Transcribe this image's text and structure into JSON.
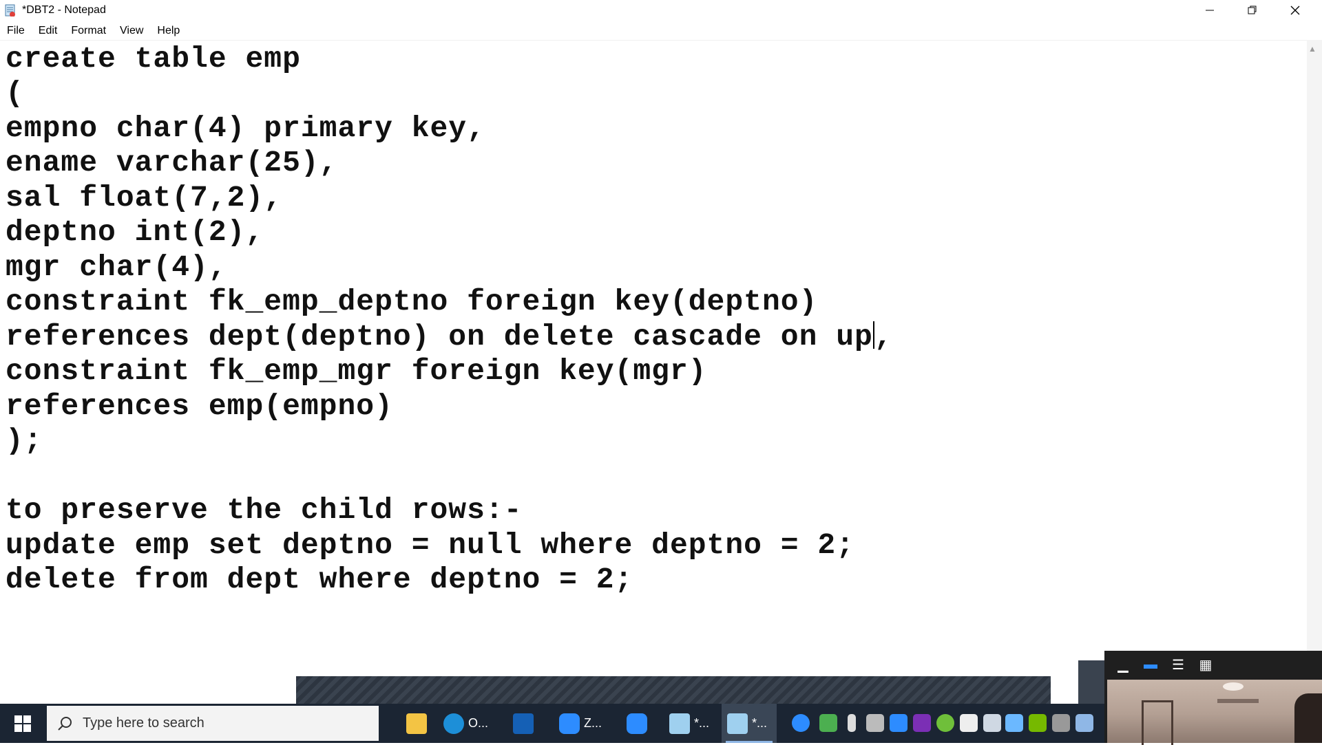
{
  "window": {
    "title": "*DBT2 - Notepad"
  },
  "menu": [
    "File",
    "Edit",
    "Format",
    "View",
    "Help"
  ],
  "editor": {
    "lines": [
      "create table emp",
      "(",
      "empno char(4) primary key,",
      "ename varchar(25),",
      "sal float(7,2),",
      "deptno int(2),",
      "mgr char(4),",
      "constraint fk_emp_deptno foreign key(deptno)",
      "references dept(deptno) on delete cascade on up",
      "constraint fk_emp_mgr foreign key(mgr)",
      "references emp(empno)",
      ");",
      "",
      "to preserve the child rows:-",
      "update emp set deptno = null where deptno = 2;",
      "delete from dept where deptno = 2;"
    ],
    "caret_suffix": ","
  },
  "taskbar": {
    "search_placeholder": "Type here to search",
    "apps": [
      {
        "icon": "file-explorer-icon",
        "label": ""
      },
      {
        "icon": "edge-icon",
        "label": "O..."
      },
      {
        "icon": "whiteboard-icon",
        "label": ""
      },
      {
        "icon": "zoom-icon",
        "label": "Z..."
      },
      {
        "icon": "zoom-meeting-icon",
        "label": ""
      },
      {
        "icon": "notepad-icon",
        "label": "*..."
      },
      {
        "icon": "notepad-icon",
        "label": "*..."
      }
    ]
  },
  "colors": {
    "taskbar_bg": "#1b2533",
    "accent": "#0078d7",
    "text": "#111111"
  }
}
